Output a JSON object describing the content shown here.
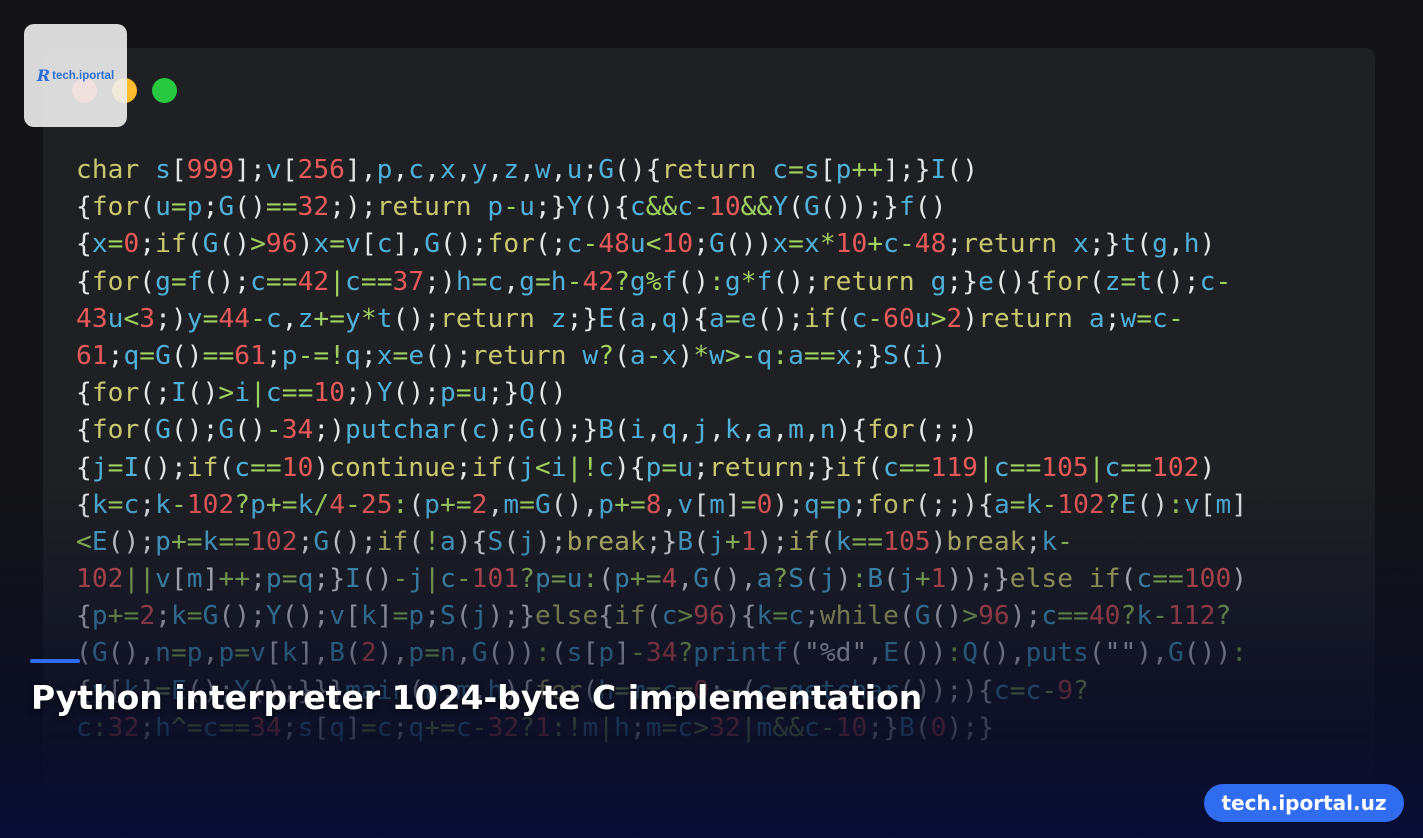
{
  "window_dots": [
    {
      "name": "close",
      "color": "#ff5f57"
    },
    {
      "name": "minimize",
      "color": "#febc2e"
    },
    {
      "name": "zoom",
      "color": "#28c840"
    }
  ],
  "code_colors": {
    "keyword": "#c8c86e",
    "identifier": "#4fb0d8",
    "number": "#e85a5a",
    "operator": "#a0d060",
    "punct": "#e6e6e6",
    "string": "#e6e6e6"
  },
  "code_lines": [
    "char s[999];v[256],p,c,x,y,z,w,u;G(){return c=s[p++];}I()",
    "{for(u=p;G()==32;);return p-u;}Y(){c&&c-10&&Y(G());}f()",
    "{x=0;if(G()>96)x=v[c],G();for(;c-48u<10;G())x=x*10+c-48;return x;}t(g,h)",
    "{for(g=f();c==42|c==37;)h=c,g=h-42?g%f():g*f();return g;}e(){for(z=t();c-",
    "43u<3;)y=44-c,z+=y*t();return z;}E(a,q){a=e();if(c-60u>2)return a;w=c-",
    "61;q=G()==61;p-=!q;x=e();return w?(a-x)*w>-q:a==x;}S(i)",
    "{for(;I()>i|c==10;)Y();p=u;}Q()",
    "{for(G();G()-34;)putchar(c);G();}B(i,q,j,k,a,m,n){for(;;)",
    "{j=I();if(c==10)continue;if(j<i|!c){p=u;return;}if(c==119|c==105|c==102)",
    "{k=c;k-102?p+=k/4-25:(p+=2,m=G(),p+=8,v[m]=0);q=p;for(;;){a=k-102?E():v[m]",
    "<E();p+=k==102;G();if(!a){S(j);break;}B(j+1);if(k==105)break;k-",
    "102||v[m]++;p=q;}I()-j|c-101?p=u:(p+=4,G(),a?S(j):B(j+1));}else if(c==100)",
    "{p+=2;k=G();Y();v[k]=p;S(j);}else{if(c>96){k=c;while(G()>96);c==40?k-112?",
    "(G(),n=p,p=v[k],B(2),p=n,G()):(s[p]-34?printf(\"%d\",E()):Q(),puts(\"\"),G()):",
    "{v[k]=E();Y();}}}main(n,m,h){for(h=m=c=0;~(c=getchar());){c=c-9?",
    "c:32;h^=c==34;s[q]=c;q+=c-32?1:!m|h;m=c>32|m&&c-10;}B(0);}"
  ],
  "logo": {
    "text": "tech.iportal",
    "mark": "R"
  },
  "headline": "Python interpreter 1024-byte C implementation",
  "site_badge": "tech.iportal.uz"
}
